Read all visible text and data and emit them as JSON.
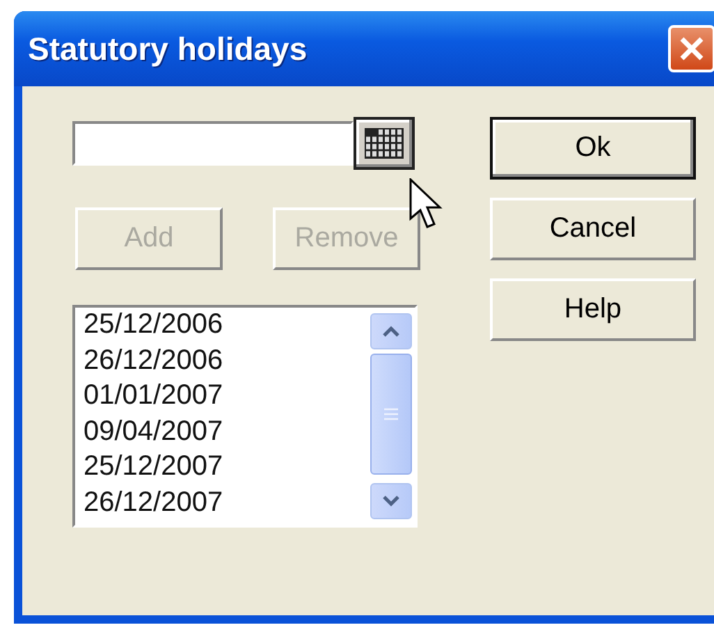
{
  "window": {
    "title": "Statutory holidays"
  },
  "list_buttons": [
    {
      "label": "Add",
      "disabled": true
    },
    {
      "label": "Remove",
      "disabled": true
    }
  ],
  "dates": [
    {
      "text": "25/12/2006",
      "selected": false
    },
    {
      "text": "26/12/2006",
      "selected": false
    },
    {
      "text": "01/01/2007",
      "selected": false
    },
    {
      "text": "09/04/2007",
      "selected": false
    },
    {
      "text": "25/12/2007",
      "selected": false
    },
    {
      "text": "26/12/2007",
      "selected": false
    }
  ],
  "dialog_buttons": [
    {
      "label": "Ok",
      "default": true
    },
    {
      "label": "Cancel",
      "default": false
    },
    {
      "label": "Help",
      "default": false
    }
  ]
}
